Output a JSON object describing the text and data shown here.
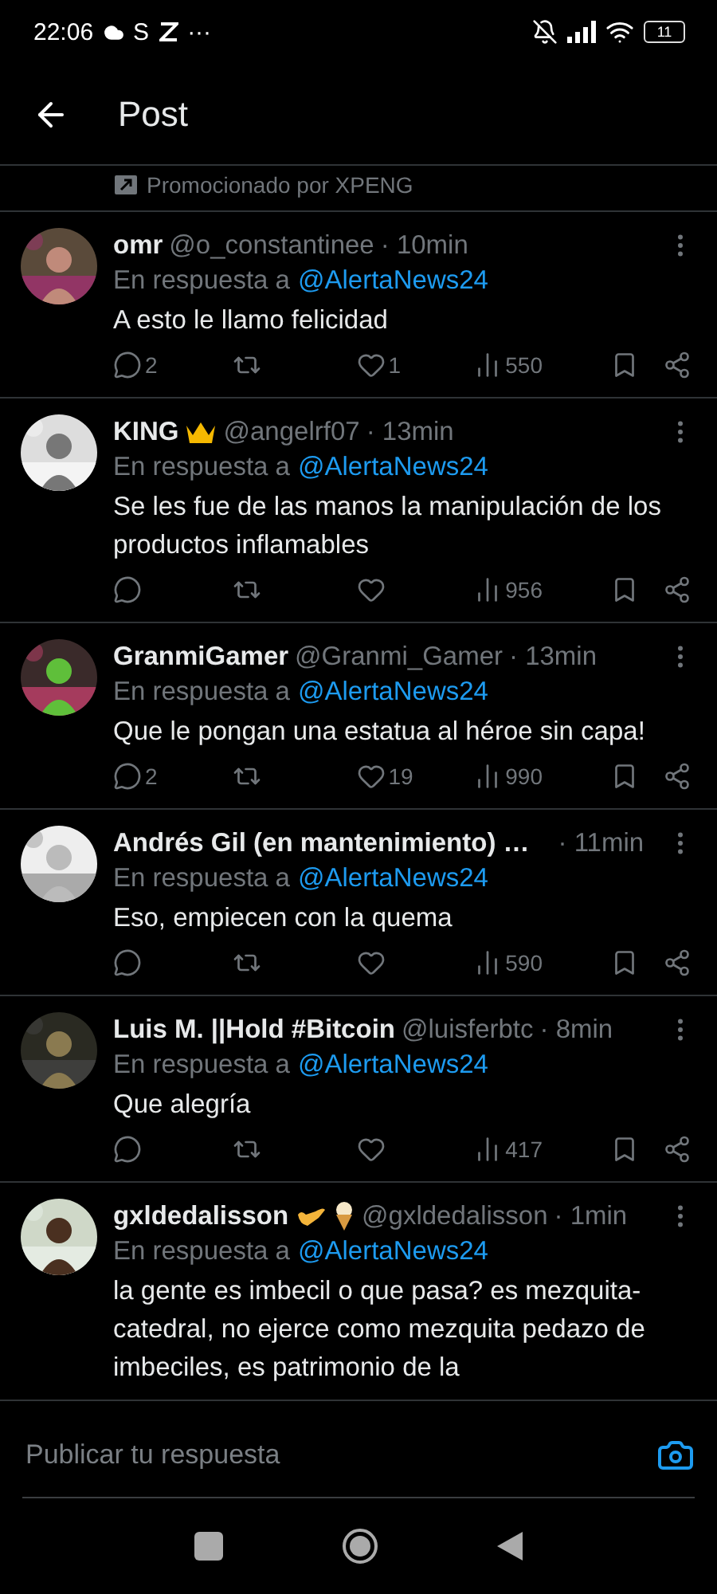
{
  "status_bar": {
    "time": "22:06",
    "app_letter": "S",
    "more": "···",
    "battery": "11"
  },
  "header": {
    "title": "Post"
  },
  "promoted": {
    "text": "Promocionado por XPENG"
  },
  "replies": [
    {
      "name": "omr",
      "handle": "@o_constantinee",
      "time": "· 10min",
      "reply_prefix": "En respuesta a",
      "reply_to": "@AlertaNews24",
      "text": "A esto le llamo felicidad",
      "comments": "2",
      "likes": "1",
      "views": "550"
    },
    {
      "name": "KING",
      "badges": [
        {
          "kind": "crown"
        }
      ],
      "handle": "@angelrf07",
      "time": "· 13min",
      "reply_prefix": "En respuesta a",
      "reply_to": "@AlertaNews24",
      "text": "Se les fue de las manos la manipulación de los productos inflamables",
      "views": "956"
    },
    {
      "name": "GranmiGamer",
      "handle": "@Granmi_Gamer",
      "time": "· 13min",
      "reply_prefix": "En respuesta a",
      "reply_to": "@AlertaNews24",
      "text": "Que le pongan una estatua al héroe sin capa!",
      "comments": "2",
      "likes": "19",
      "views": "990"
    },
    {
      "name": "Andrés Gil (en mantenimiento) …",
      "time": "· 11min",
      "reply_prefix": "En respuesta a",
      "reply_to": "@AlertaNews24",
      "text": "Eso, empiecen con la quema",
      "views": "590"
    },
    {
      "name": "Luis M. ||Hold #Bitcoin",
      "handle": "@luisferbtc",
      "time": "· 8min",
      "reply_prefix": "En respuesta a",
      "reply_to": "@AlertaNews24",
      "text": "Que alegría",
      "views": "417"
    },
    {
      "name": "gxldedalisson",
      "badges": [
        {
          "kind": "call-hand"
        },
        {
          "kind": "ice-cream"
        }
      ],
      "handle": "@gxldedalisson",
      "time": "· 1min",
      "reply_prefix": "En respuesta a",
      "reply_to": "@AlertaNews24",
      "text": "la gente es imbecil o que pasa? es mezquita-catedral, no ejerce como mezquita pedazo de imbeciles, es patrimonio de la"
    }
  ],
  "composer": {
    "placeholder": "Publicar tu respuesta"
  }
}
